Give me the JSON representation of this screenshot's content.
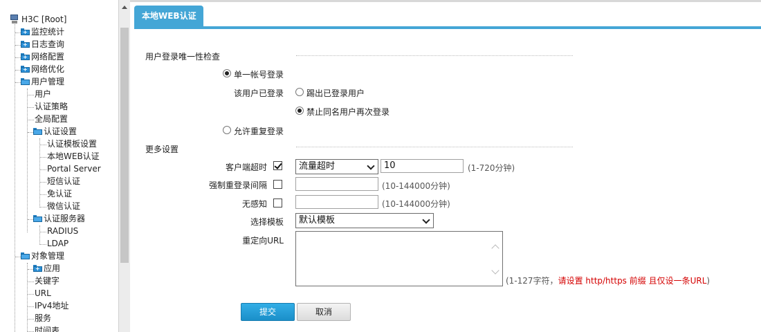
{
  "sidebar": {
    "root": "H3C [Root]",
    "items": [
      {
        "label": "监控统计"
      },
      {
        "label": "日志查询"
      },
      {
        "label": "网络配置"
      },
      {
        "label": "网络优化"
      },
      {
        "label": "用户管理"
      },
      {
        "label": "用户"
      },
      {
        "label": "认证策略"
      },
      {
        "label": "全局配置"
      },
      {
        "label": "认证设置"
      },
      {
        "label": "认证模板设置"
      },
      {
        "label": "本地WEB认证"
      },
      {
        "label": "Portal Server"
      },
      {
        "label": "短信认证"
      },
      {
        "label": "免认证"
      },
      {
        "label": "微信认证"
      },
      {
        "label": "认证服务器"
      },
      {
        "label": "RADIUS"
      },
      {
        "label": "LDAP"
      },
      {
        "label": "对象管理"
      },
      {
        "label": "应用"
      },
      {
        "label": "关键字"
      },
      {
        "label": "URL"
      },
      {
        "label": "IPv4地址"
      },
      {
        "label": "服务"
      },
      {
        "label": "时间表"
      }
    ]
  },
  "tab": {
    "label": "本地WEB认证"
  },
  "login_check": {
    "title": "用户登录唯一性检查",
    "single_login": "单一帐号登录",
    "already_logged": "该用户已登录",
    "kick_out": "踢出已登录用户",
    "forbid_same": "禁止同名用户再次登录",
    "allow_repeat": "允许重复登录",
    "single_selected": true,
    "forbid_selected": true
  },
  "more": {
    "title": "更多设置",
    "client_timeout": {
      "label": "客户端超时",
      "checked": true,
      "select": "流量超时",
      "value": "10",
      "hint": "(1-720分钟)"
    },
    "force_relogin": {
      "label": "强制重登录间隔",
      "checked": false,
      "value": "",
      "hint": "(10-144000分钟)"
    },
    "seamless": {
      "label": "无感知",
      "checked": false,
      "value": "",
      "hint": "(10-144000分钟)"
    },
    "template": {
      "label": "选择模板",
      "select": "默认模板"
    },
    "redirect": {
      "label": "重定向URL",
      "value": "",
      "hint_prefix": "(1-127字符，",
      "hint_red": "请设置 http/https 前缀 且仅设一条URL",
      "hint_suffix": ")"
    }
  },
  "buttons": {
    "submit": "提交",
    "cancel": "取消"
  },
  "colors": {
    "accent": "#44a6d6",
    "primary_button": "#1b8fc9",
    "hint_red": "#d40000"
  }
}
